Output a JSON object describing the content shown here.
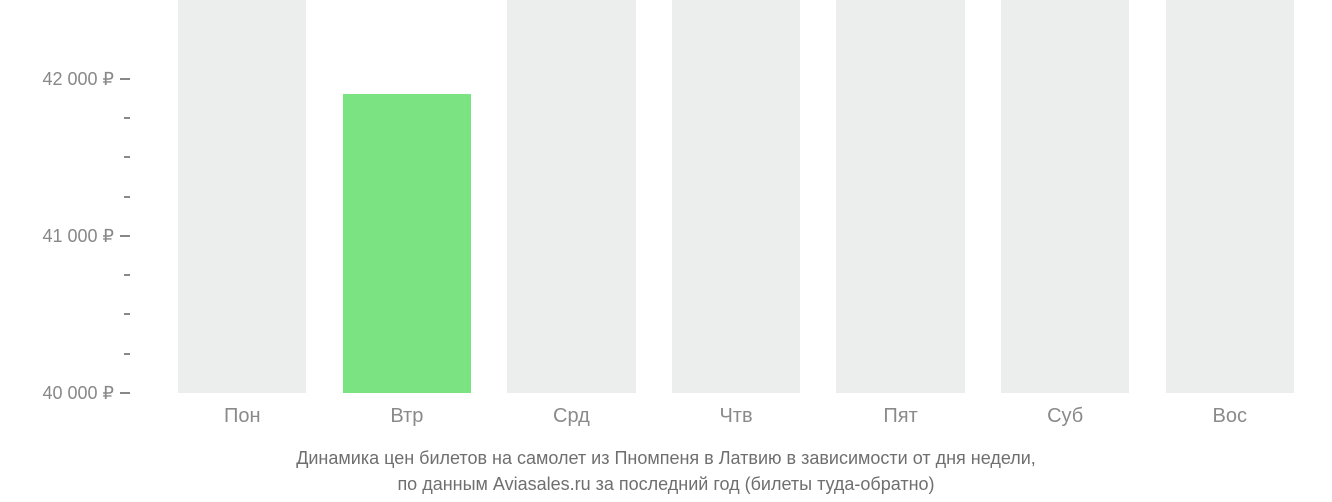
{
  "chart_data": {
    "type": "bar",
    "categories": [
      "Пон",
      "Втр",
      "Срд",
      "Чтв",
      "Пят",
      "Суб",
      "Вос"
    ],
    "values": [
      42500,
      41900,
      42500,
      42500,
      42500,
      42500,
      42500
    ],
    "highlight_index": 1,
    "ylabel": "",
    "xlabel": "",
    "y_ticks_major": [
      {
        "value": 42000,
        "label": "42 000 ₽"
      },
      {
        "value": 41000,
        "label": "41 000 ₽"
      },
      {
        "value": 40000,
        "label": "40 000 ₽"
      }
    ],
    "y_ticks_minor": [
      41750,
      41500,
      41250,
      40750,
      40500,
      40250
    ],
    "ylim": [
      40000,
      42500
    ],
    "colors": {
      "bar": "#eceded",
      "highlight": "#7be382"
    },
    "caption_line1": "Динамика цен билетов на самолет из Пномпеня в Латвию в зависимости от дня недели,",
    "caption_line2": "по данным Aviasales.ru за последний год (билеты туда-обратно)"
  }
}
